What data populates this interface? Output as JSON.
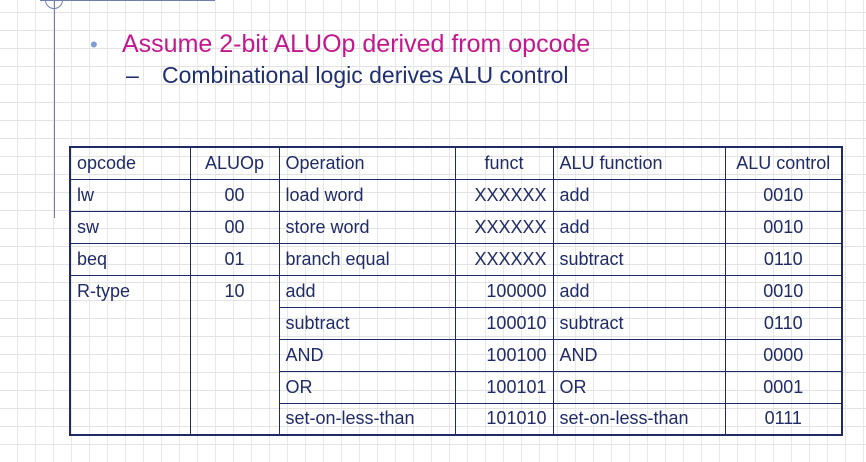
{
  "bullets": {
    "main": "Assume 2-bit ALUOp derived from opcode",
    "sub": "Combinational logic derives ALU control"
  },
  "table": {
    "headers": [
      "opcode",
      "ALUOp",
      "Operation",
      "funct",
      "ALU function",
      "ALU control"
    ],
    "rows": [
      [
        "lw",
        "00",
        "load word",
        "XXXXXX",
        "add",
        "0010"
      ],
      [
        "sw",
        "00",
        "store word",
        "XXXXXX",
        "add",
        "0010"
      ],
      [
        "beq",
        "01",
        "branch equal",
        "XXXXXX",
        "subtract",
        "0110"
      ],
      [
        "R-type",
        "10",
        "add",
        "100000",
        "add",
        "0010"
      ],
      [
        "",
        "",
        "subtract",
        "100010",
        "subtract",
        "0110"
      ],
      [
        "",
        "",
        "AND",
        "100100",
        "AND",
        "0000"
      ],
      [
        "",
        "",
        "OR",
        "100101",
        "OR",
        "0001"
      ],
      [
        "",
        "",
        "set-on-less-than",
        "101010",
        "set-on-less-than",
        "0111"
      ]
    ]
  },
  "colors": {
    "bullet_text": "#c2188f",
    "sub_text": "#1f2f6e",
    "table_border": "#1f2b66"
  }
}
